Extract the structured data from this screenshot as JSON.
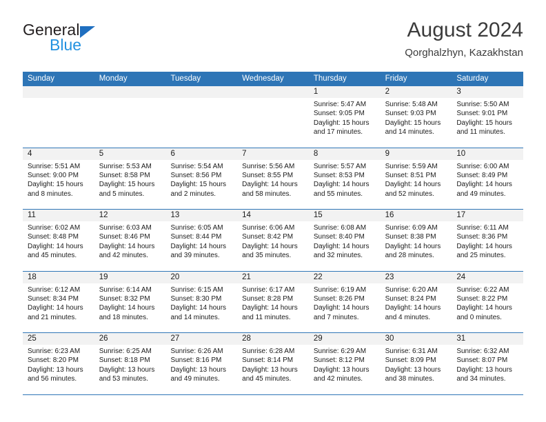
{
  "brand": {
    "line1": "General",
    "line2": "Blue",
    "triangle_color": "#1f6fc0",
    "line2_color": "#2392e0"
  },
  "header": {
    "title": "August 2024",
    "subtitle": "Qorghalzhyn, Kazakhstan",
    "accent_color": "#2e75b6",
    "band_color": "#f2f2f2"
  },
  "weekdays": [
    "Sunday",
    "Monday",
    "Tuesday",
    "Wednesday",
    "Thursday",
    "Friday",
    "Saturday"
  ],
  "weeks": [
    [
      {
        "date": "",
        "sunrise": "",
        "sunset": "",
        "daylight_line1": "",
        "daylight_line2": "",
        "empty": true
      },
      {
        "date": "",
        "sunrise": "",
        "sunset": "",
        "daylight_line1": "",
        "daylight_line2": "",
        "empty": true
      },
      {
        "date": "",
        "sunrise": "",
        "sunset": "",
        "daylight_line1": "",
        "daylight_line2": "",
        "empty": true
      },
      {
        "date": "",
        "sunrise": "",
        "sunset": "",
        "daylight_line1": "",
        "daylight_line2": "",
        "empty": true
      },
      {
        "date": "1",
        "sunrise": "Sunrise: 5:47 AM",
        "sunset": "Sunset: 9:05 PM",
        "daylight_line1": "Daylight: 15 hours",
        "daylight_line2": "and 17 minutes."
      },
      {
        "date": "2",
        "sunrise": "Sunrise: 5:48 AM",
        "sunset": "Sunset: 9:03 PM",
        "daylight_line1": "Daylight: 15 hours",
        "daylight_line2": "and 14 minutes."
      },
      {
        "date": "3",
        "sunrise": "Sunrise: 5:50 AM",
        "sunset": "Sunset: 9:01 PM",
        "daylight_line1": "Daylight: 15 hours",
        "daylight_line2": "and 11 minutes."
      }
    ],
    [
      {
        "date": "4",
        "sunrise": "Sunrise: 5:51 AM",
        "sunset": "Sunset: 9:00 PM",
        "daylight_line1": "Daylight: 15 hours",
        "daylight_line2": "and 8 minutes."
      },
      {
        "date": "5",
        "sunrise": "Sunrise: 5:53 AM",
        "sunset": "Sunset: 8:58 PM",
        "daylight_line1": "Daylight: 15 hours",
        "daylight_line2": "and 5 minutes."
      },
      {
        "date": "6",
        "sunrise": "Sunrise: 5:54 AM",
        "sunset": "Sunset: 8:56 PM",
        "daylight_line1": "Daylight: 15 hours",
        "daylight_line2": "and 2 minutes."
      },
      {
        "date": "7",
        "sunrise": "Sunrise: 5:56 AM",
        "sunset": "Sunset: 8:55 PM",
        "daylight_line1": "Daylight: 14 hours",
        "daylight_line2": "and 58 minutes."
      },
      {
        "date": "8",
        "sunrise": "Sunrise: 5:57 AM",
        "sunset": "Sunset: 8:53 PM",
        "daylight_line1": "Daylight: 14 hours",
        "daylight_line2": "and 55 minutes."
      },
      {
        "date": "9",
        "sunrise": "Sunrise: 5:59 AM",
        "sunset": "Sunset: 8:51 PM",
        "daylight_line1": "Daylight: 14 hours",
        "daylight_line2": "and 52 minutes."
      },
      {
        "date": "10",
        "sunrise": "Sunrise: 6:00 AM",
        "sunset": "Sunset: 8:49 PM",
        "daylight_line1": "Daylight: 14 hours",
        "daylight_line2": "and 49 minutes."
      }
    ],
    [
      {
        "date": "11",
        "sunrise": "Sunrise: 6:02 AM",
        "sunset": "Sunset: 8:48 PM",
        "daylight_line1": "Daylight: 14 hours",
        "daylight_line2": "and 45 minutes."
      },
      {
        "date": "12",
        "sunrise": "Sunrise: 6:03 AM",
        "sunset": "Sunset: 8:46 PM",
        "daylight_line1": "Daylight: 14 hours",
        "daylight_line2": "and 42 minutes."
      },
      {
        "date": "13",
        "sunrise": "Sunrise: 6:05 AM",
        "sunset": "Sunset: 8:44 PM",
        "daylight_line1": "Daylight: 14 hours",
        "daylight_line2": "and 39 minutes."
      },
      {
        "date": "14",
        "sunrise": "Sunrise: 6:06 AM",
        "sunset": "Sunset: 8:42 PM",
        "daylight_line1": "Daylight: 14 hours",
        "daylight_line2": "and 35 minutes."
      },
      {
        "date": "15",
        "sunrise": "Sunrise: 6:08 AM",
        "sunset": "Sunset: 8:40 PM",
        "daylight_line1": "Daylight: 14 hours",
        "daylight_line2": "and 32 minutes."
      },
      {
        "date": "16",
        "sunrise": "Sunrise: 6:09 AM",
        "sunset": "Sunset: 8:38 PM",
        "daylight_line1": "Daylight: 14 hours",
        "daylight_line2": "and 28 minutes."
      },
      {
        "date": "17",
        "sunrise": "Sunrise: 6:11 AM",
        "sunset": "Sunset: 8:36 PM",
        "daylight_line1": "Daylight: 14 hours",
        "daylight_line2": "and 25 minutes."
      }
    ],
    [
      {
        "date": "18",
        "sunrise": "Sunrise: 6:12 AM",
        "sunset": "Sunset: 8:34 PM",
        "daylight_line1": "Daylight: 14 hours",
        "daylight_line2": "and 21 minutes."
      },
      {
        "date": "19",
        "sunrise": "Sunrise: 6:14 AM",
        "sunset": "Sunset: 8:32 PM",
        "daylight_line1": "Daylight: 14 hours",
        "daylight_line2": "and 18 minutes."
      },
      {
        "date": "20",
        "sunrise": "Sunrise: 6:15 AM",
        "sunset": "Sunset: 8:30 PM",
        "daylight_line1": "Daylight: 14 hours",
        "daylight_line2": "and 14 minutes."
      },
      {
        "date": "21",
        "sunrise": "Sunrise: 6:17 AM",
        "sunset": "Sunset: 8:28 PM",
        "daylight_line1": "Daylight: 14 hours",
        "daylight_line2": "and 11 minutes."
      },
      {
        "date": "22",
        "sunrise": "Sunrise: 6:19 AM",
        "sunset": "Sunset: 8:26 PM",
        "daylight_line1": "Daylight: 14 hours",
        "daylight_line2": "and 7 minutes."
      },
      {
        "date": "23",
        "sunrise": "Sunrise: 6:20 AM",
        "sunset": "Sunset: 8:24 PM",
        "daylight_line1": "Daylight: 14 hours",
        "daylight_line2": "and 4 minutes."
      },
      {
        "date": "24",
        "sunrise": "Sunrise: 6:22 AM",
        "sunset": "Sunset: 8:22 PM",
        "daylight_line1": "Daylight: 14 hours",
        "daylight_line2": "and 0 minutes."
      }
    ],
    [
      {
        "date": "25",
        "sunrise": "Sunrise: 6:23 AM",
        "sunset": "Sunset: 8:20 PM",
        "daylight_line1": "Daylight: 13 hours",
        "daylight_line2": "and 56 minutes."
      },
      {
        "date": "26",
        "sunrise": "Sunrise: 6:25 AM",
        "sunset": "Sunset: 8:18 PM",
        "daylight_line1": "Daylight: 13 hours",
        "daylight_line2": "and 53 minutes."
      },
      {
        "date": "27",
        "sunrise": "Sunrise: 6:26 AM",
        "sunset": "Sunset: 8:16 PM",
        "daylight_line1": "Daylight: 13 hours",
        "daylight_line2": "and 49 minutes."
      },
      {
        "date": "28",
        "sunrise": "Sunrise: 6:28 AM",
        "sunset": "Sunset: 8:14 PM",
        "daylight_line1": "Daylight: 13 hours",
        "daylight_line2": "and 45 minutes."
      },
      {
        "date": "29",
        "sunrise": "Sunrise: 6:29 AM",
        "sunset": "Sunset: 8:12 PM",
        "daylight_line1": "Daylight: 13 hours",
        "daylight_line2": "and 42 minutes."
      },
      {
        "date": "30",
        "sunrise": "Sunrise: 6:31 AM",
        "sunset": "Sunset: 8:09 PM",
        "daylight_line1": "Daylight: 13 hours",
        "daylight_line2": "and 38 minutes."
      },
      {
        "date": "31",
        "sunrise": "Sunrise: 6:32 AM",
        "sunset": "Sunset: 8:07 PM",
        "daylight_line1": "Daylight: 13 hours",
        "daylight_line2": "and 34 minutes."
      }
    ]
  ]
}
